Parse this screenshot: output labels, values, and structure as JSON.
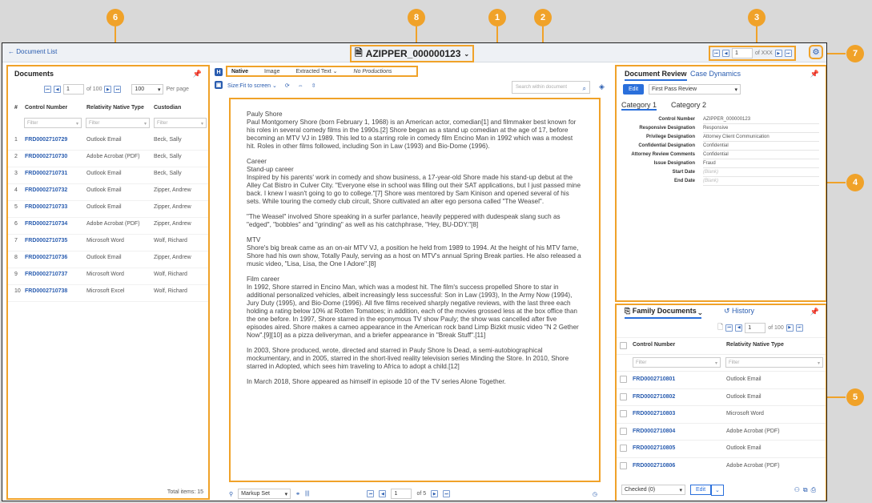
{
  "topbar": {
    "back": "Document List",
    "title": "AZIPPER_000000123",
    "page_value": "1",
    "of_label": "of XXX"
  },
  "left": {
    "title": "Documents",
    "page_value": "1",
    "of_label": "of 100",
    "per_page_value": "100",
    "per_page_label": "Per page",
    "headers": {
      "num": "#",
      "control": "Control Number",
      "type": "Relativity Native Type",
      "custodian": "Custodian"
    },
    "filter_placeholder": "Filter",
    "rows": [
      {
        "num": "1",
        "control": "FRD0002710729",
        "type": "Outlook Email",
        "custodian": "Beck, Sally"
      },
      {
        "num": "2",
        "control": "FRD0002710730",
        "type": "Adobe Acrobat (PDF)",
        "custodian": "Beck, Sally"
      },
      {
        "num": "3",
        "control": "FRD0002710731",
        "type": "Outlook Email",
        "custodian": "Beck, Sally"
      },
      {
        "num": "4",
        "control": "FRD0002710732",
        "type": "Outlook Email",
        "custodian": "Zipper, Andrew"
      },
      {
        "num": "5",
        "control": "FRD0002710733",
        "type": "Outlook Email",
        "custodian": "Zipper, Andrew"
      },
      {
        "num": "6",
        "control": "FRD0002710734",
        "type": "Adobe Acrobat (PDF)",
        "custodian": "Zipper, Andrew"
      },
      {
        "num": "7",
        "control": "FRD0002710735",
        "type": "Microsoft Word",
        "custodian": "Wolf, Richard"
      },
      {
        "num": "8",
        "control": "FRD0002710736",
        "type": "Outlook Email",
        "custodian": "Zipper, Andrew"
      },
      {
        "num": "9",
        "control": "FRD0002710737",
        "type": "Microsoft Word",
        "custodian": "Wolf, Richard"
      },
      {
        "num": "10",
        "control": "FRD0002710738",
        "type": "Microsoft Excel",
        "custodian": "Wolf, Richard"
      }
    ],
    "total": "Total items: 15"
  },
  "viewer": {
    "tabs": [
      "Native",
      "Image",
      "Extracted Text ⌄",
      "No Productions"
    ],
    "size": "Size:Fit to screen ⌄",
    "search_placeholder": "Search within document",
    "paragraphs": [
      "Pauly Shore\nPaul Montgomery Shore (born February 1, 1968) is an American actor, comedian[1] and filmmaker best known for his roles in several comedy films in the 1990s.[2] Shore began as a stand up comedian at the age of 17, before becoming an MTV VJ in 1989. This led to a starring role in comedy film Encino Man in 1992 which was a modest hit. Roles in other films followed, including Son in Law (1993) and Bio-Dome (1996).",
      "Career\nStand-up career\nInspired by his parents' work in comedy and show business, a 17-year-old Shore made his stand-up debut at the Alley Cat Bistro in Culver City. \"Everyone else in school was filling out their SAT applications, but I just passed mine back. I knew I wasn't going to go to college.\"[7] Shore was mentored by Sam Kinison and opened several of his sets. While touring the comedy club circuit, Shore cultivated an alter ego persona called \"The Weasel\".",
      "\"The Weasel\" involved Shore speaking in a surfer parlance, heavily peppered with dudespeak slang such as \"edged\", \"bobbles\" and \"grinding\" as well as his catchphrase, \"Hey, BU-DDY.\"[8]",
      "MTV\nShore's big break came as an on-air MTV VJ, a position he held from 1989 to 1994. At the height of his MTV fame, Shore had his own show, Totally Pauly, serving as a host on MTV's annual Spring Break parties. He also released a music video, \"Lisa, Lisa, the One I Adore\".[8]",
      "Film career\nIn 1992, Shore starred in Encino Man, which was a modest hit. The film's success propelled Shore to star in additional personalized vehicles, albeit increasingly less successful: Son in Law (1993), In the Army Now (1994), Jury Duty (1995), and Bio-Dome (1996). All five films received sharply negative reviews, with the last three each holding a rating below 10% at Rotten Tomatoes; in addition, each of the movies grossed less at the box office than the one before. In 1997, Shore starred in the eponymous TV show Pauly; the show was cancelled after five episodes aired. Shore makes a cameo appearance in the American rock band Limp Bizkit music video \"N 2 Gether Now\".[9][10] as a pizza deliveryman, and a briefer appearance in \"Break Stuff\".[11]",
      "In 2003, Shore produced, wrote, directed and starred in Pauly Shore Is Dead, a semi-autobiographical mockumentary, and in 2005, starred in the short-lived reality television series Minding the Store. In 2010, Shore starred in Adopted, which sees him traveling to Africa to adopt a child.[12]",
      "In March 2018, Shore appeared as himself in episode 10 of the TV series Alone Together."
    ],
    "markup": "Markup Set",
    "page_value": "1",
    "of_label": "of 5"
  },
  "review": {
    "tab1": "Document Review",
    "tab2": "Case Dynamics",
    "edit": "Edit",
    "layout": "First Pass Review",
    "cat1": "Category 1",
    "cat2": "Category 2",
    "fields": [
      {
        "k": "Control Number",
        "v": "AZIPPER_000000123"
      },
      {
        "k": "Responsive Designation",
        "v": "Responsive"
      },
      {
        "k": "Privilege Designation",
        "v": "Attorney Client Communication"
      },
      {
        "k": "Confidential Designation",
        "v": "Confidential"
      },
      {
        "k": "Attorney Review Comments",
        "v": "Confidential"
      },
      {
        "k": "Issue Designation",
        "v": "Fraud"
      },
      {
        "k": "Start Date",
        "v": "(Blank)"
      },
      {
        "k": "End Date",
        "v": "(Blank)"
      }
    ]
  },
  "family": {
    "tab1": "Family Documents ⌄",
    "tab2": "History",
    "page_value": "1",
    "of_label": "of 100",
    "headers": {
      "control": "Control Number",
      "type": "Relativity Native Type"
    },
    "filter_placeholder": "Filter",
    "rows": [
      {
        "control": "FRD0002710801",
        "type": "Outlook Email"
      },
      {
        "control": "FRD0002710802",
        "type": "Outlook Email"
      },
      {
        "control": "FRD0002710803",
        "type": "Microsoft Word"
      },
      {
        "control": "FRD0002710804",
        "type": "Adobe Acrobat (PDF)"
      },
      {
        "control": "FRD0002710805",
        "type": "Outlook Email"
      },
      {
        "control": "FRD0002710806",
        "type": "Adobe Acrobat (PDF)"
      }
    ],
    "checked": "Checked (0)",
    "edit": "Edit"
  },
  "badges": [
    "1",
    "2",
    "3",
    "4",
    "5",
    "6",
    "7",
    "8"
  ]
}
